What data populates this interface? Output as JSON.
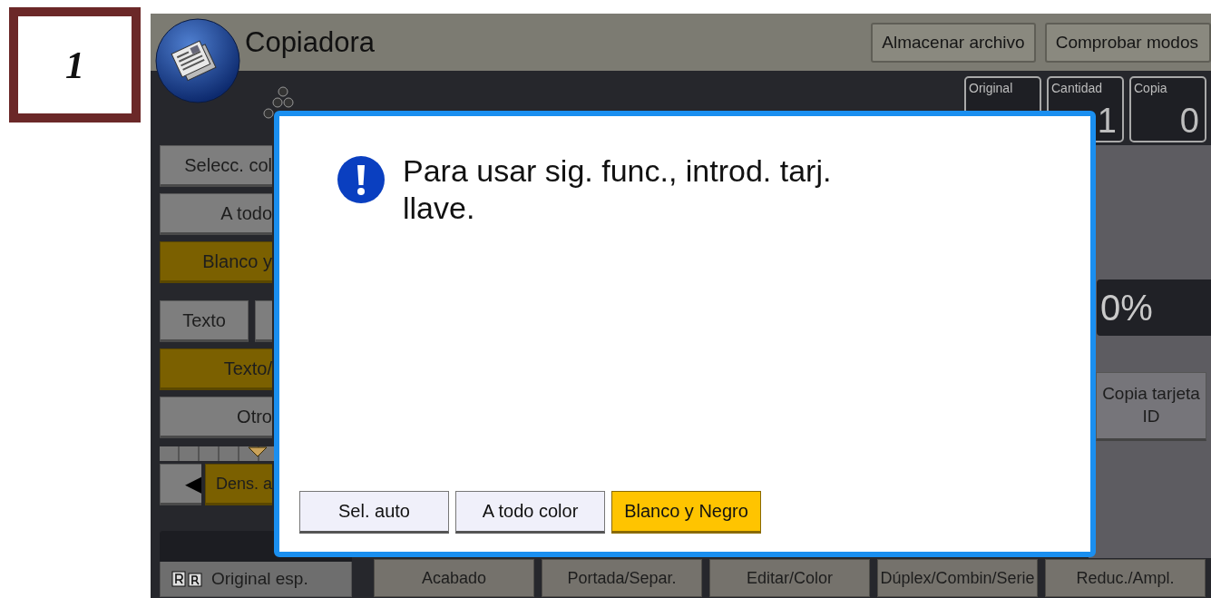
{
  "badge": {
    "text": "1"
  },
  "header": {
    "title": "Copiadora",
    "buttons": [
      "Almacenar archivo",
      "Comprobar modos"
    ]
  },
  "counters": [
    {
      "label": "Original"
    },
    {
      "label": "Cantidad",
      "value": "1"
    },
    {
      "label": "Copia",
      "value": "0"
    }
  ],
  "left_panel": {
    "color_buttons": [
      {
        "label": "Selecc. col",
        "selected": false
      },
      {
        "label": "A todo",
        "selected": false
      },
      {
        "label": "Blanco y",
        "selected": true
      }
    ],
    "type_buttons": [
      {
        "label": "Texto",
        "selected": false
      },
      {
        "label": "Texto/",
        "selected": true
      },
      {
        "label": "Otro",
        "selected": false
      }
    ],
    "density": {
      "level": 0.5,
      "arrow": "◀",
      "label": "Dens. a"
    },
    "original_button": "Original esp."
  },
  "right_panel": {
    "magnification": "0%",
    "id_card_button": "Copia tarjeta ID"
  },
  "bottom_tabs": [
    {
      "label": "Acabado"
    },
    {
      "label": "Portada/Separ."
    },
    {
      "label": "Editar/Color"
    },
    {
      "label": "Dúplex/Combin/Serie"
    },
    {
      "label": "Reduc./Ampl."
    }
  ],
  "dialog": {
    "message": "Para usar sig. func., introd. tarj. llave.",
    "buttons": [
      {
        "label": "Sel. auto",
        "selected": false
      },
      {
        "label": "A todo color",
        "selected": false
      },
      {
        "label": "Blanco y Negro",
        "selected": true
      }
    ]
  }
}
